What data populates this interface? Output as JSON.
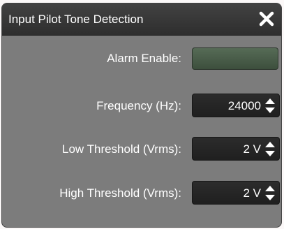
{
  "dialog": {
    "title": "Input Pilot Tone Detection",
    "close_icon": "close-x-icon"
  },
  "alarm_enable": {
    "label": "Alarm Enable:",
    "state_color": "#4d614d"
  },
  "frequency": {
    "label": "Frequency (Hz):",
    "value": "24000"
  },
  "low_threshold": {
    "label": "Low  Threshold (Vrms):",
    "value": "2 V"
  },
  "high_threshold": {
    "label": "High Threshold (Vrms):",
    "value": "2 V"
  },
  "colors": {
    "titlebar": "#363636",
    "panel": "#7c7c7c",
    "control": "#252525",
    "text": "#ffffff"
  }
}
